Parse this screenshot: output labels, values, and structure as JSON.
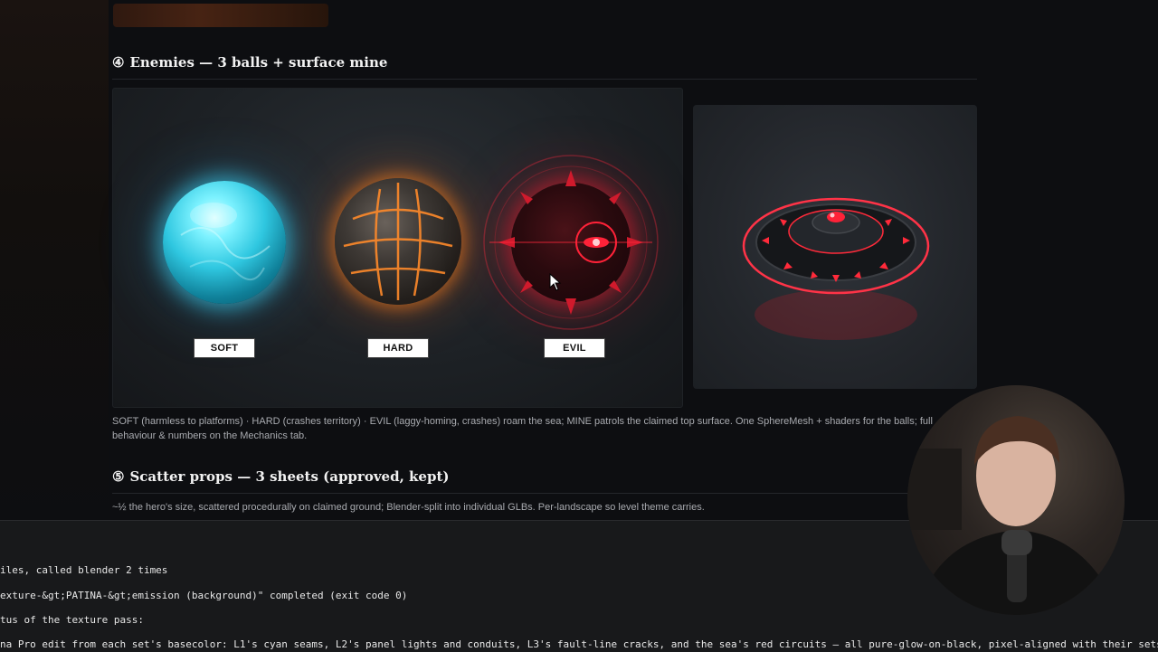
{
  "sections": {
    "enemies": {
      "number": "④",
      "title": "Enemies — 3 balls + surface mine"
    },
    "scatter": {
      "number": "⑤",
      "title": "Scatter props — 3 sheets (approved, kept)"
    }
  },
  "enemy_labels": {
    "soft": "SOFT",
    "hard": "HARD",
    "evil": "EVIL"
  },
  "caption_enemies": "SOFT (harmless to platforms) · HARD (crashes territory) · EVIL (laggy-homing, crashes) roam the sea; MINE patrols the claimed top surface. One SphereMesh + shaders for the balls; full behaviour & numbers on the Mechanics tab.",
  "caption_scatter": "~½ the hero's size, scattered procedurally on claimed ground; Blender-split into individual GLBs. Per-landscape so level theme carries.",
  "terminal": {
    "line1": "iles, called blender 2 times",
    "line2": "exture-&gt;PATINA-&gt;emission (background)\" completed (exit code 0)",
    "line3": "tus of the texture pass:",
    "line4": "na Pro edit from each set's basecolor: L1's cyan seams, L2's panel lights and conduits, L3's fault-line cracks, and the sea's red circuits — all pure-glow-on-black, pixel-aligned with their sets."
  },
  "colors": {
    "soft": "#3fd8f0",
    "hard": "#ff8a2a",
    "evil": "#ff2238",
    "mine": "#ff2a3a"
  },
  "icons": [
    "cursor-arrow-icon",
    "webcam-person"
  ]
}
